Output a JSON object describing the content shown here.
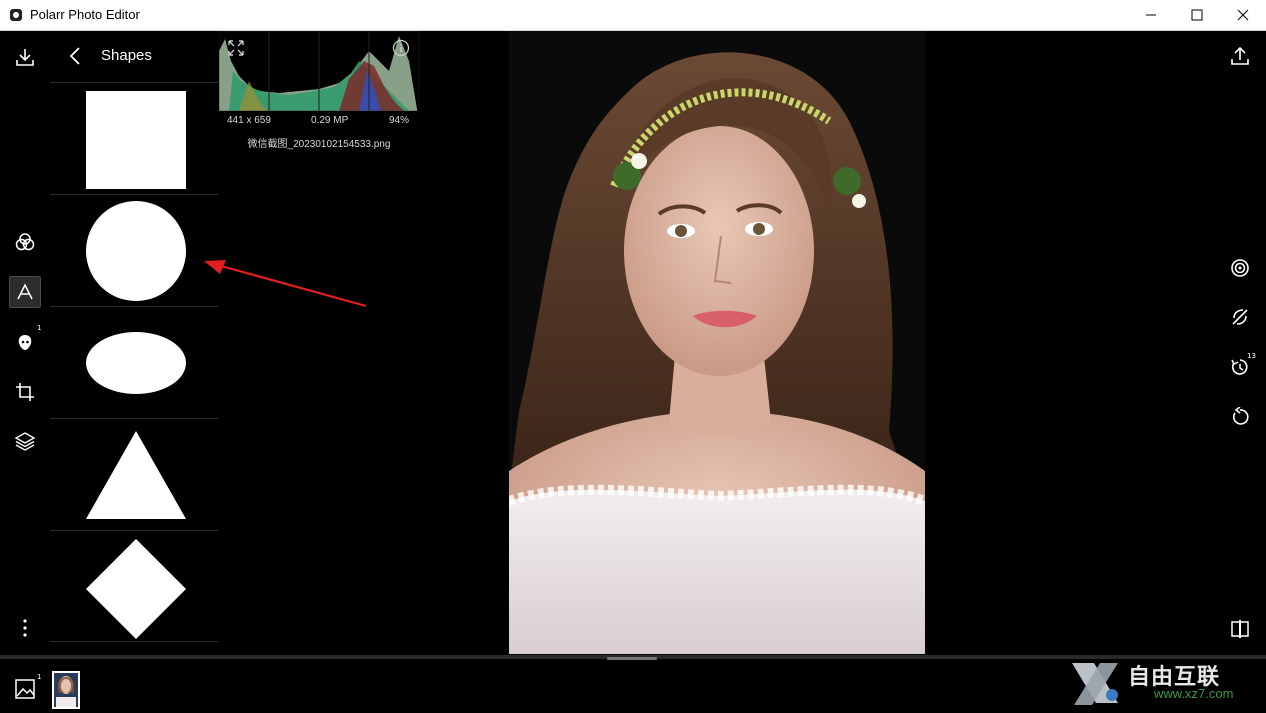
{
  "window": {
    "title": "Polarr Photo Editor"
  },
  "left_toolbar": {
    "icons": [
      "download-icon",
      "filters-icon",
      "text-icon",
      "face-icon",
      "crop-icon",
      "layers-icon",
      "more-icon"
    ],
    "face_badge": "1"
  },
  "shapes_panel": {
    "title": "Shapes",
    "shapes": [
      "square",
      "circle",
      "ellipse",
      "triangle",
      "diamond"
    ]
  },
  "image_info": {
    "dimensions": "441 x 659",
    "megapixels": "0.29 MP",
    "zoom": "94%",
    "filename": "微信截图_20230102154533.png"
  },
  "right_toolbar": {
    "icons": [
      "export-icon",
      "brush-icon",
      "healing-icon",
      "history-icon",
      "reset-icon",
      "compare-icon"
    ],
    "history_badge": "13"
  },
  "bottom_bar": {
    "gallery_badge": "1"
  },
  "watermark": {
    "text": "自由互联",
    "url": "www.xz7.com"
  },
  "colors": {
    "accent": "#ffffff",
    "annotation_arrow": "#e02020",
    "background": "#000000"
  }
}
